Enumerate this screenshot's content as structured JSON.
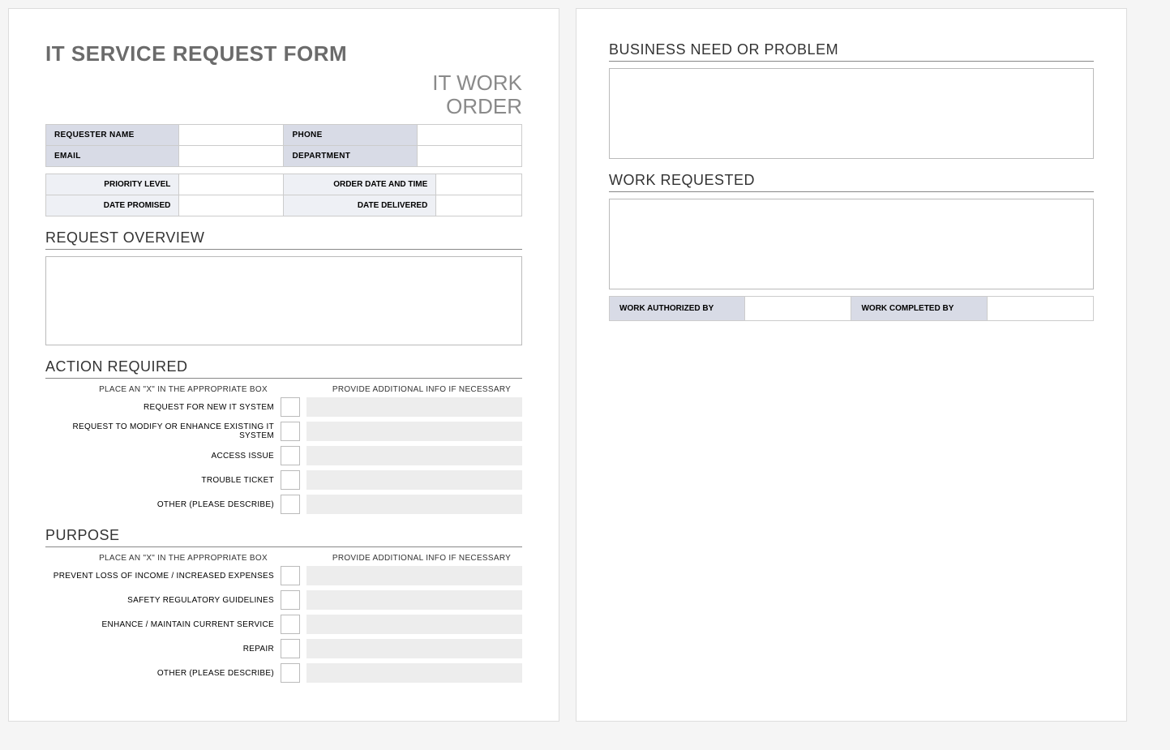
{
  "title": "IT SERVICE REQUEST FORM",
  "subtitle_line1": "IT WORK",
  "subtitle_line2": "ORDER",
  "requester_table": {
    "requester_name_label": "REQUESTER NAME",
    "requester_name_value": "",
    "phone_label": "PHONE",
    "phone_value": "",
    "email_label": "EMAIL",
    "email_value": "",
    "department_label": "DEPARTMENT",
    "department_value": ""
  },
  "order_table": {
    "priority_label": "PRIORITY LEVEL",
    "priority_value": "",
    "order_date_label": "ORDER DATE AND TIME",
    "order_date_value": "",
    "date_promised_label": "DATE PROMISED",
    "date_promised_value": "",
    "date_delivered_label": "DATE DELIVERED",
    "date_delivered_value": ""
  },
  "sections": {
    "request_overview": "REQUEST OVERVIEW",
    "action_required": "ACTION REQUIRED",
    "purpose": "PURPOSE",
    "business_need": "BUSINESS NEED OR PROBLEM",
    "work_requested": "WORK REQUESTED"
  },
  "instructions": {
    "place_x": "PLACE AN \"X\" IN THE APPROPRIATE BOX",
    "additional_info": "PROVIDE ADDITIONAL INFO IF NECESSARY"
  },
  "action_items": [
    {
      "label": "REQUEST FOR NEW IT SYSTEM",
      "checked": "",
      "info": ""
    },
    {
      "label": "REQUEST TO MODIFY OR ENHANCE EXISTING IT SYSTEM",
      "checked": "",
      "info": ""
    },
    {
      "label": "ACCESS ISSUE",
      "checked": "",
      "info": ""
    },
    {
      "label": "TROUBLE TICKET",
      "checked": "",
      "info": ""
    },
    {
      "label": "OTHER (PLEASE DESCRIBE)",
      "checked": "",
      "info": ""
    }
  ],
  "purpose_items": [
    {
      "label": "PREVENT LOSS OF INCOME / INCREASED EXPENSES",
      "checked": "",
      "info": ""
    },
    {
      "label": "SAFETY REGULATORY GUIDELINES",
      "checked": "",
      "info": ""
    },
    {
      "label": "ENHANCE / MAINTAIN CURRENT SERVICE",
      "checked": "",
      "info": ""
    },
    {
      "label": "REPAIR",
      "checked": "",
      "info": ""
    },
    {
      "label": "OTHER (PLEASE DESCRIBE)",
      "checked": "",
      "info": ""
    }
  ],
  "request_overview_text": "",
  "business_need_text": "",
  "work_requested_text": "",
  "auth_table": {
    "authorized_by_label": "WORK AUTHORIZED BY",
    "authorized_by_value": "",
    "completed_by_label": "WORK COMPLETED BY",
    "completed_by_value": ""
  }
}
